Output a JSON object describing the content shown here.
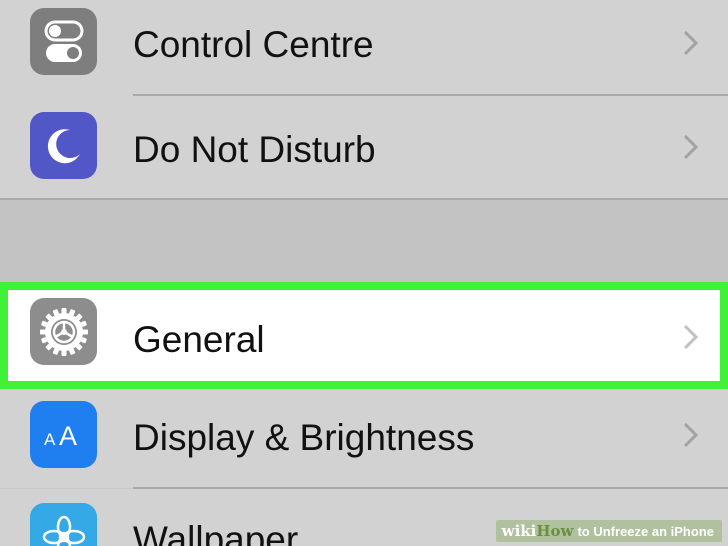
{
  "settings": {
    "rows": [
      {
        "label": "Control Centre",
        "icon": "toggle-switches-icon",
        "icon_color": "#7e7e7e"
      },
      {
        "label": "Do Not Disturb",
        "icon": "moon-icon",
        "icon_color": "#5257c8"
      },
      {
        "label": "General",
        "icon": "gear-icon",
        "icon_color": "#8d8d8d"
      },
      {
        "label": "Display & Brightness",
        "icon": "text-size-icon",
        "icon_color": "#1f7ef0"
      },
      {
        "label": "Wallpaper",
        "icon": "flower-icon",
        "icon_color": "#35a9e6"
      }
    ],
    "highlight_color": "#3ff238"
  },
  "watermark": {
    "brand_a": "wiki",
    "brand_b": "How",
    "text": "to Unfreeze an iPhone"
  }
}
